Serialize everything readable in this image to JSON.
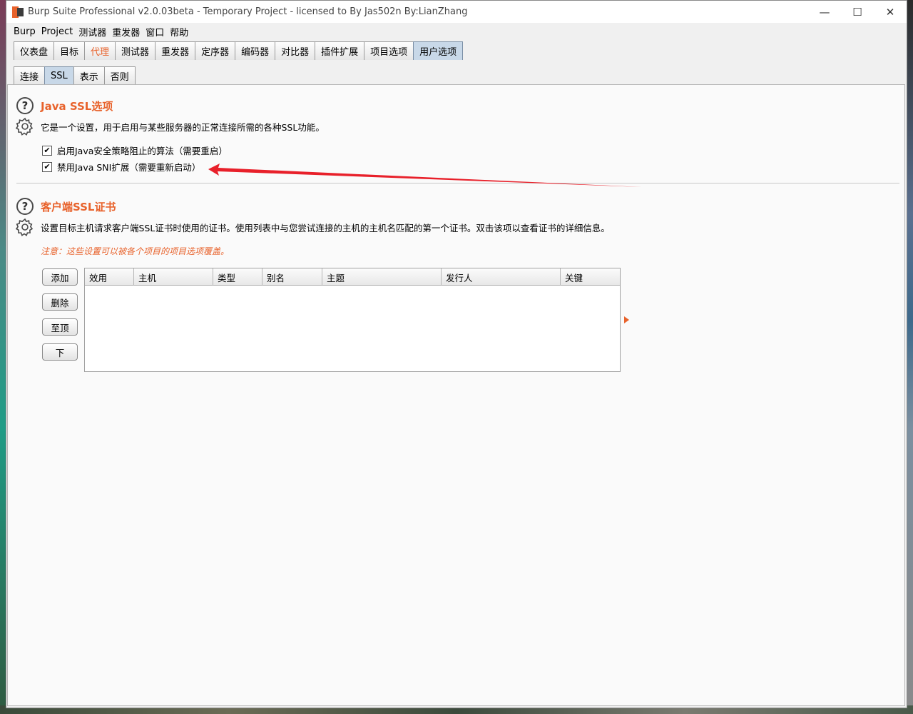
{
  "window": {
    "title": "Burp Suite Professional v2.0.03beta - Temporary Project - licensed to By Jas502n By:LianZhang"
  },
  "menu": [
    "Burp",
    "Project",
    "测试器",
    "重发器",
    "窗口",
    "帮助"
  ],
  "tabs": [
    {
      "label": "仪表盘"
    },
    {
      "label": "目标"
    },
    {
      "label": "代理"
    },
    {
      "label": "测试器"
    },
    {
      "label": "重发器"
    },
    {
      "label": "定序器"
    },
    {
      "label": "编码器"
    },
    {
      "label": "对比器"
    },
    {
      "label": "插件扩展"
    },
    {
      "label": "项目选项"
    },
    {
      "label": "用户选项"
    }
  ],
  "subtabs": [
    {
      "label": "连接"
    },
    {
      "label": "SSL"
    },
    {
      "label": "表示"
    },
    {
      "label": "否则"
    }
  ],
  "java_ssl": {
    "title": "Java SSL选项",
    "description": "它是一个设置，用于启用与某些服务器的正常连接所需的各种SSL功能。",
    "options": [
      {
        "label": "启用Java安全策略阻止的算法（需要重启）",
        "checked": true
      },
      {
        "label": "禁用Java SNI扩展（需要重新启动）",
        "checked": true
      }
    ]
  },
  "client_cert": {
    "title": "客户端SSL证书",
    "description": "设置目标主机请求客户端SSL证书时使用的证书。使用列表中与您尝试连接的主机的主机名匹配的第一个证书。双击该项以查看证书的详细信息。",
    "note": "注意：这些设置可以被各个项目的项目选项覆盖。",
    "buttons": {
      "add": "添加",
      "remove": "删除",
      "up": "至顶",
      "down": "下"
    },
    "columns": [
      "效用",
      "主机",
      "类型",
      "别名",
      "主题",
      "发行人",
      "关键"
    ]
  },
  "colors": {
    "accent": "#e8622b",
    "annotation_arrow": "#e8202a"
  },
  "icons": [
    "help-icon",
    "gear-icon",
    "minimize-icon",
    "maximize-icon",
    "close-icon",
    "burp-logo-icon"
  ]
}
